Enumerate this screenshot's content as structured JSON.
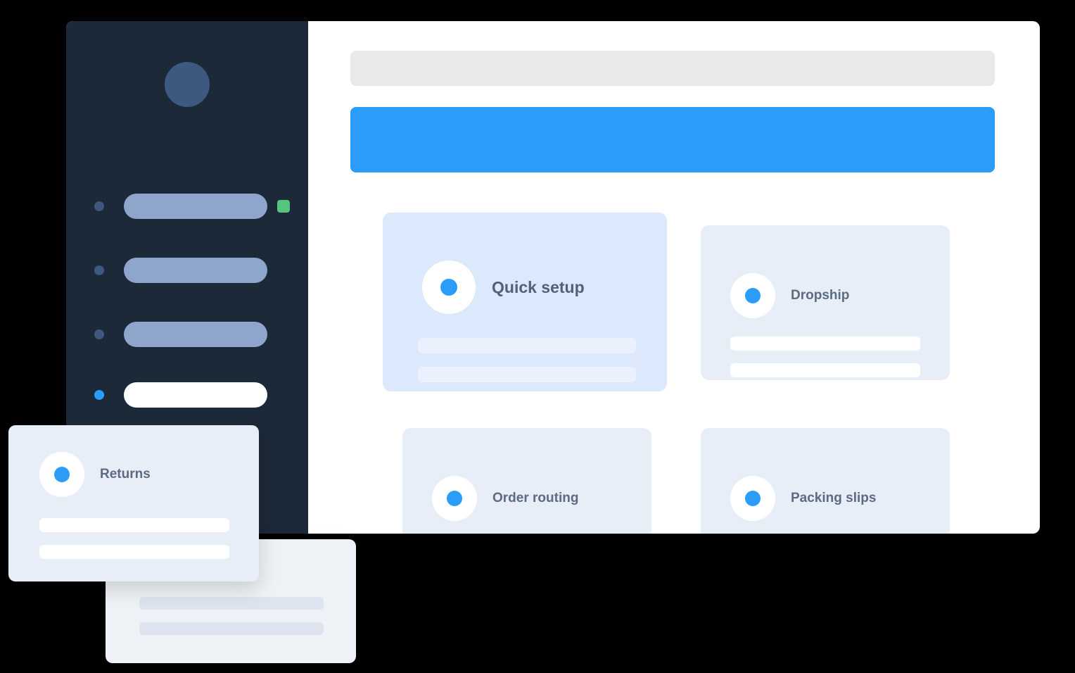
{
  "window": {
    "sidebar": {
      "avatar_name": "user-avatar",
      "items": [
        {
          "id": "nav-item-1",
          "state": "inactive",
          "badge": true,
          "badge_color": "#55c47c"
        },
        {
          "id": "nav-item-2",
          "state": "inactive",
          "badge": false
        },
        {
          "id": "nav-item-3",
          "state": "inactive",
          "badge": false
        },
        {
          "id": "nav-item-4",
          "state": "active",
          "badge": false
        }
      ]
    },
    "content": {
      "search_bar": {
        "name": "search-bar",
        "placeholder": ""
      },
      "primary_banner": {
        "name": "primary-banner",
        "color": "#2b9df8"
      },
      "cards": [
        {
          "id": "quick-setup",
          "title": "Quick setup",
          "highlight": true
        },
        {
          "id": "dropship",
          "title": "Dropship",
          "highlight": false
        },
        {
          "id": "order-routing",
          "title": "Order routing",
          "highlight": false
        },
        {
          "id": "packing-slips",
          "title": "Packing slips",
          "highlight": false
        }
      ]
    },
    "floating_cards": [
      {
        "id": "returns",
        "title": "Returns"
      },
      {
        "id": "placeholder-card",
        "title": ""
      }
    ]
  },
  "colors": {
    "sidebar_bg": "#1c2938",
    "accent": "#2b9df8",
    "badge_green": "#55c47c",
    "card_bg": "#e8eef8",
    "card_highlight_bg": "#dce8fb",
    "title_text": "#5c6b7f"
  }
}
